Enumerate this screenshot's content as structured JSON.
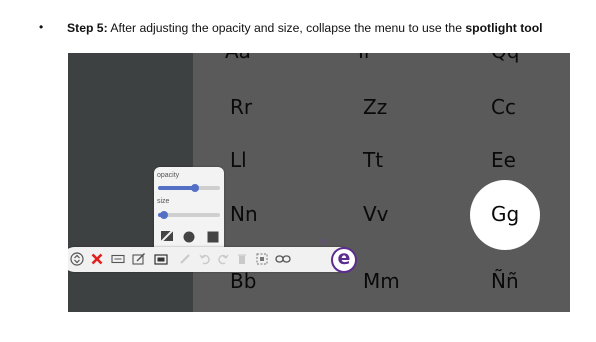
{
  "instruction": {
    "bullet": "•",
    "prefix": "Step 5:",
    "middle": " After adjusting the opacity and size, collapse the menu to use the ",
    "emphasis": "spotlight tool"
  },
  "letter_chart": {
    "rows": [
      [
        "Aa",
        "Ii",
        "Qq"
      ],
      [
        "Rr",
        "Zz",
        "Cc"
      ],
      [
        "Ll",
        "Tt",
        "Ee"
      ],
      [
        "Nn",
        "Vv",
        "Gg"
      ],
      [
        "Bb",
        "Mm",
        "Ññ"
      ]
    ]
  },
  "popup": {
    "opacity_label": "opacity",
    "size_label": "size",
    "opacity_level": 0.6,
    "size_level": 0.1
  },
  "toolbar": {
    "tools": [
      "collapse-toggle-icon",
      "close-icon",
      "keyboard-icon",
      "edit-box-icon",
      "screen-capture-icon",
      "pen-icon",
      "undo-icon",
      "redo-icon",
      "trash-icon",
      "selection-icon",
      "link-icon",
      "logo-icon"
    ],
    "logo_letter": "e",
    "registered_mark": "®"
  },
  "colors": {
    "screen_bg": "#5a5a5a",
    "left_panel": "#3e4142",
    "accent": "#5470c6",
    "close_red": "#e02020",
    "logo_purple": "#5b2d8e"
  }
}
